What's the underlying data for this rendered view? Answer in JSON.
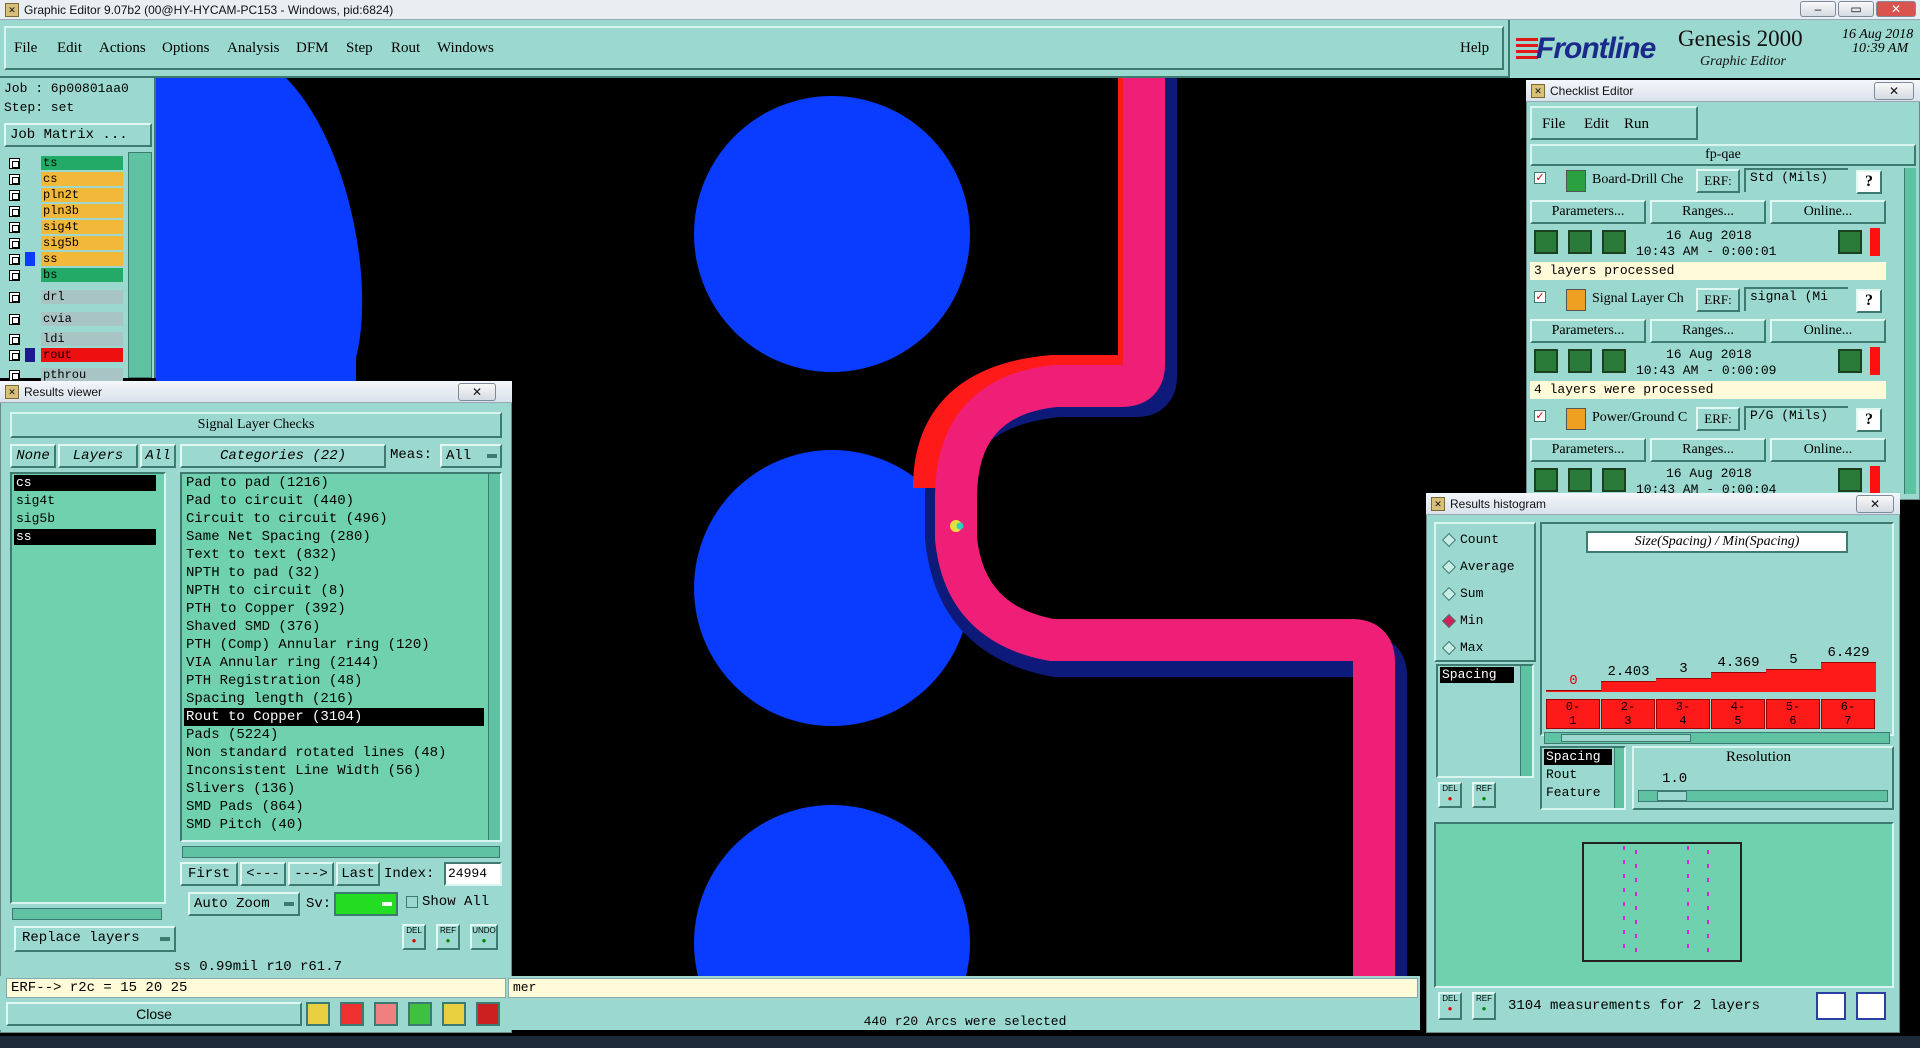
{
  "window": {
    "title": "Graphic Editor 9.07b2 (00@HY-HYCAM-PC153 - Windows, pid:6824)"
  },
  "menu": {
    "items": [
      "File",
      "Edit",
      "Actions",
      "Options",
      "Analysis",
      "DFM",
      "Step",
      "Rout",
      "Windows"
    ],
    "help": "Help"
  },
  "brand": {
    "logo": "Frontline",
    "product": "Genesis 2000",
    "subtitle": "Graphic Editor",
    "date": "16 Aug 2018",
    "time": "10:39 AM"
  },
  "job": {
    "job_label": "Job : 6p00801aa0",
    "step_label": "Step: set",
    "matrix_button": "Job Matrix ..."
  },
  "layers": [
    {
      "name": "ts",
      "color": "#22aa66"
    },
    {
      "name": "cs",
      "color": "#f2b83a"
    },
    {
      "name": "pln2t",
      "color": "#f2b83a"
    },
    {
      "name": "pln3b",
      "color": "#f2b83a"
    },
    {
      "name": "sig4t",
      "color": "#f2b83a"
    },
    {
      "name": "sig5b",
      "color": "#f2b83a"
    },
    {
      "name": "ss",
      "color": "#f2b83a"
    },
    {
      "name": "bs",
      "color": "#22aa66"
    },
    {
      "name": "drl",
      "color": "#a9c4c4"
    },
    {
      "name": "cvia",
      "color": "#a9c4c4"
    },
    {
      "name": "ldi",
      "color": "#a9c4c4"
    },
    {
      "name": "rout",
      "color": "#a9c4c4"
    },
    {
      "name": "pthrou",
      "color": "#a9c4c4"
    }
  ],
  "results_viewer": {
    "title": "Results viewer",
    "header": "Signal Layer Checks",
    "none_btn": "None",
    "layers_btn": "Layers",
    "all_btn": "All",
    "layer_list": [
      "cs",
      "sig4t",
      "sig5b",
      "ss"
    ],
    "categories_label": "Categories (22)",
    "meas_label": "Meas:",
    "meas_value": "All",
    "categories": [
      "Pad to pad (1216)",
      "Pad to circuit (440)",
      "Circuit to circuit (496)",
      "Same Net Spacing (280)",
      "Text to text (832)",
      "NPTH to pad (32)",
      "NPTH to circuit (8)",
      "PTH to Copper (392)",
      "Shaved SMD (376)",
      "PTH (Comp) Annular ring (120)",
      "VIA Annular ring (2144)",
      "PTH Registration (48)",
      "Spacing length (216)",
      "Rout to Copper (3104)",
      "Pads (5224)",
      "Non standard rotated lines (48)",
      "Inconsistent Line Width (56)",
      "Slivers (136)",
      "SMD Pads (864)",
      "SMD Pitch (40)"
    ],
    "selected_category": "Rout to Copper (3104)",
    "first_btn": "First",
    "prev_btn": "<---",
    "next_btn": "--->",
    "last_btn": "Last",
    "index_label": "Index:",
    "index_value": "24994",
    "auto_zoom": "Auto Zoom",
    "sv_label": "Sv:",
    "show_all": "Show All",
    "replace_layers": "Replace layers",
    "del": "DEL",
    "ref": "REF",
    "undo": "UNDO",
    "measure_line": "ss 0.99mil  r10  r61.7",
    "erf_line": "ERF--> r2c = 15 20 25",
    "close_btn": "Close"
  },
  "checklist": {
    "title": "Checklist Editor",
    "menu": [
      "File",
      "Edit",
      "Run"
    ],
    "name": "fp-qae",
    "checks": [
      {
        "name": "Board-Drill Che",
        "erf": "ERF:",
        "erf_value": "Std (Mils)",
        "date": "16 Aug 2018",
        "time": "10:43 AM - 0:00:01",
        "status": "3 layers processed"
      },
      {
        "name": "Signal Layer Ch",
        "erf": "ERF:",
        "erf_value": "signal (Mi",
        "date": "16 Aug 2018",
        "time": "10:43 AM - 0:00:09",
        "status": "4 layers were processed"
      },
      {
        "name": "Power/Ground C",
        "erf": "ERF:",
        "erf_value": "P/G (Mils)",
        "date": "16 Aug 2018",
        "time": "10:43 AM - 0:00:04",
        "status": ""
      }
    ],
    "parameters_btn": "Parameters...",
    "ranges_btn": "Ranges...",
    "online_btn": "Online...",
    "help_btn": "?"
  },
  "histogram": {
    "title": "Results histogram",
    "modes": [
      "Count",
      "Average",
      "Sum",
      "Min",
      "Max"
    ],
    "selected_mode": "Min",
    "measure_list": [
      "Spacing"
    ],
    "chart_title": "Size(Spacing) / Min(Spacing)",
    "resolution_label": "Resolution",
    "resolution_value": "1.0",
    "field_list": [
      "Spacing",
      "Rout",
      "Feature"
    ],
    "footer": "3104 measurements for 2 layers",
    "del": "DEL",
    "ref": "REF"
  },
  "chart_data": {
    "type": "bar",
    "title": "Size(Spacing) / Min(Spacing)",
    "categories": [
      "0-1",
      "2-3",
      "3-4",
      "4-5",
      "5-6",
      "6-7"
    ],
    "values": [
      0,
      2.403,
      3,
      4.369,
      5,
      6.429
    ],
    "value_labels": [
      "0",
      "2.403",
      "3",
      "4.369",
      "5",
      "6.429"
    ],
    "color": "#ff1a1a"
  },
  "status": {
    "left": "mer",
    "center": "440 r20 Arcs were selected"
  },
  "colors": {
    "panel": "#9bd9d0",
    "list_bg": "#6fd1ad",
    "pad_blue": "#0a3cff",
    "rout_pink": "#ef1f78",
    "shadow_navy": "#0e1a7a",
    "red_trace": "#ff0000"
  }
}
